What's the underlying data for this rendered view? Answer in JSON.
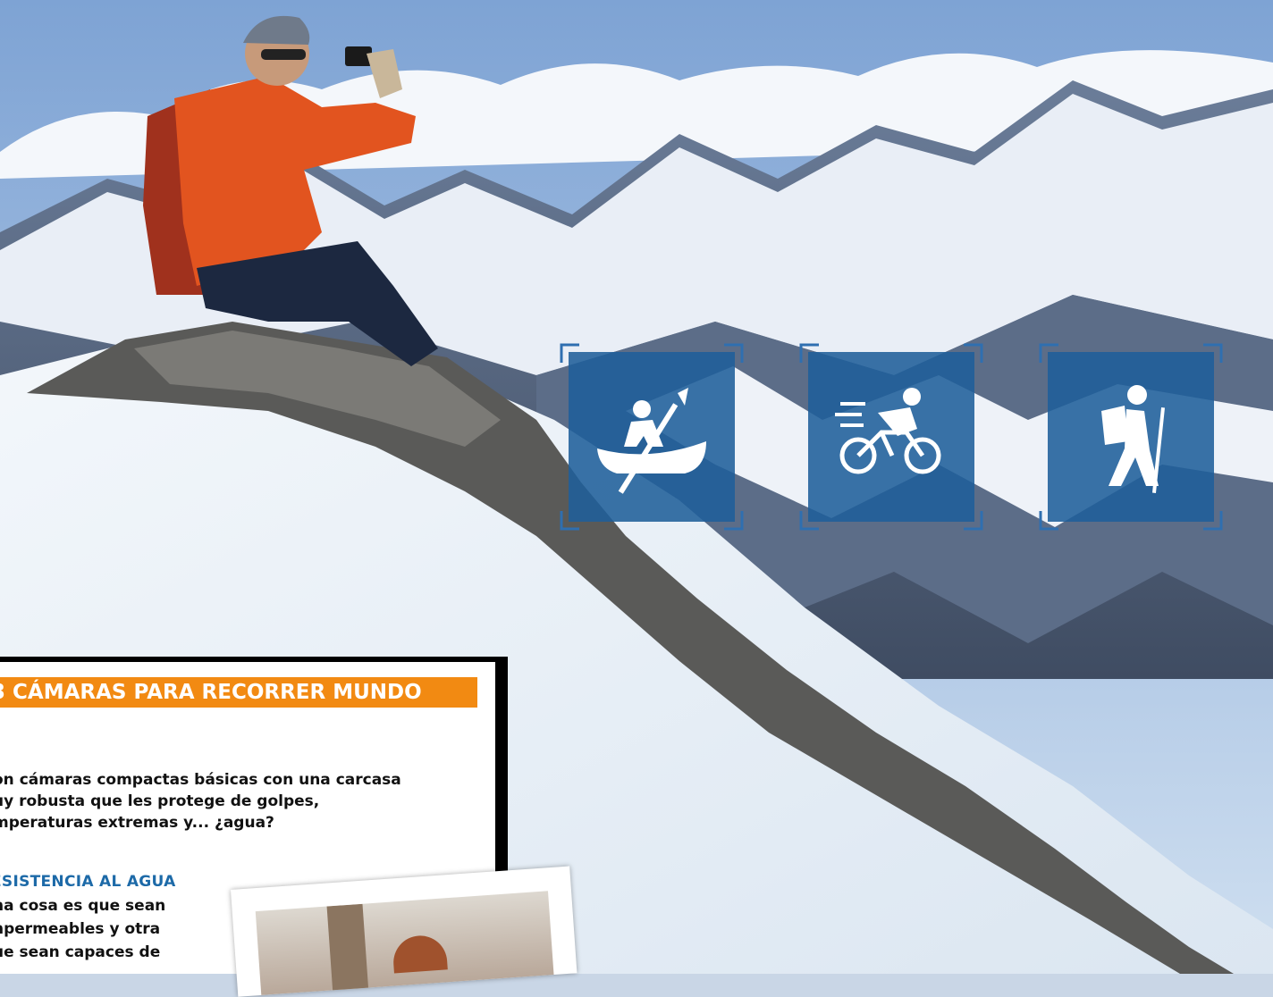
{
  "sidebox": {
    "banner": "3 CÁMARAS PARA RECORRER MUNDO",
    "intro_lines": [
      "on cámaras compactas básicas con una carcasa",
      "uy robusta que les protege de golpes,",
      "mperaturas extremas y... ¿agua?"
    ],
    "subhead": "ESISTENCIA AL AGUA",
    "body_lines": [
      "na cosa es que sean",
      "npermeables y otra",
      "ue sean capaces de"
    ]
  },
  "activities": [
    {
      "name": "kayak",
      "icon": "kayak-icon"
    },
    {
      "name": "cycling",
      "icon": "cyclist-icon"
    },
    {
      "name": "hiking",
      "icon": "hiker-icon"
    }
  ],
  "colors": {
    "banner": "#f28a12",
    "subhead": "#1d6aa8",
    "tile": "#1f5f9a",
    "bracket": "#2f6fb0"
  }
}
